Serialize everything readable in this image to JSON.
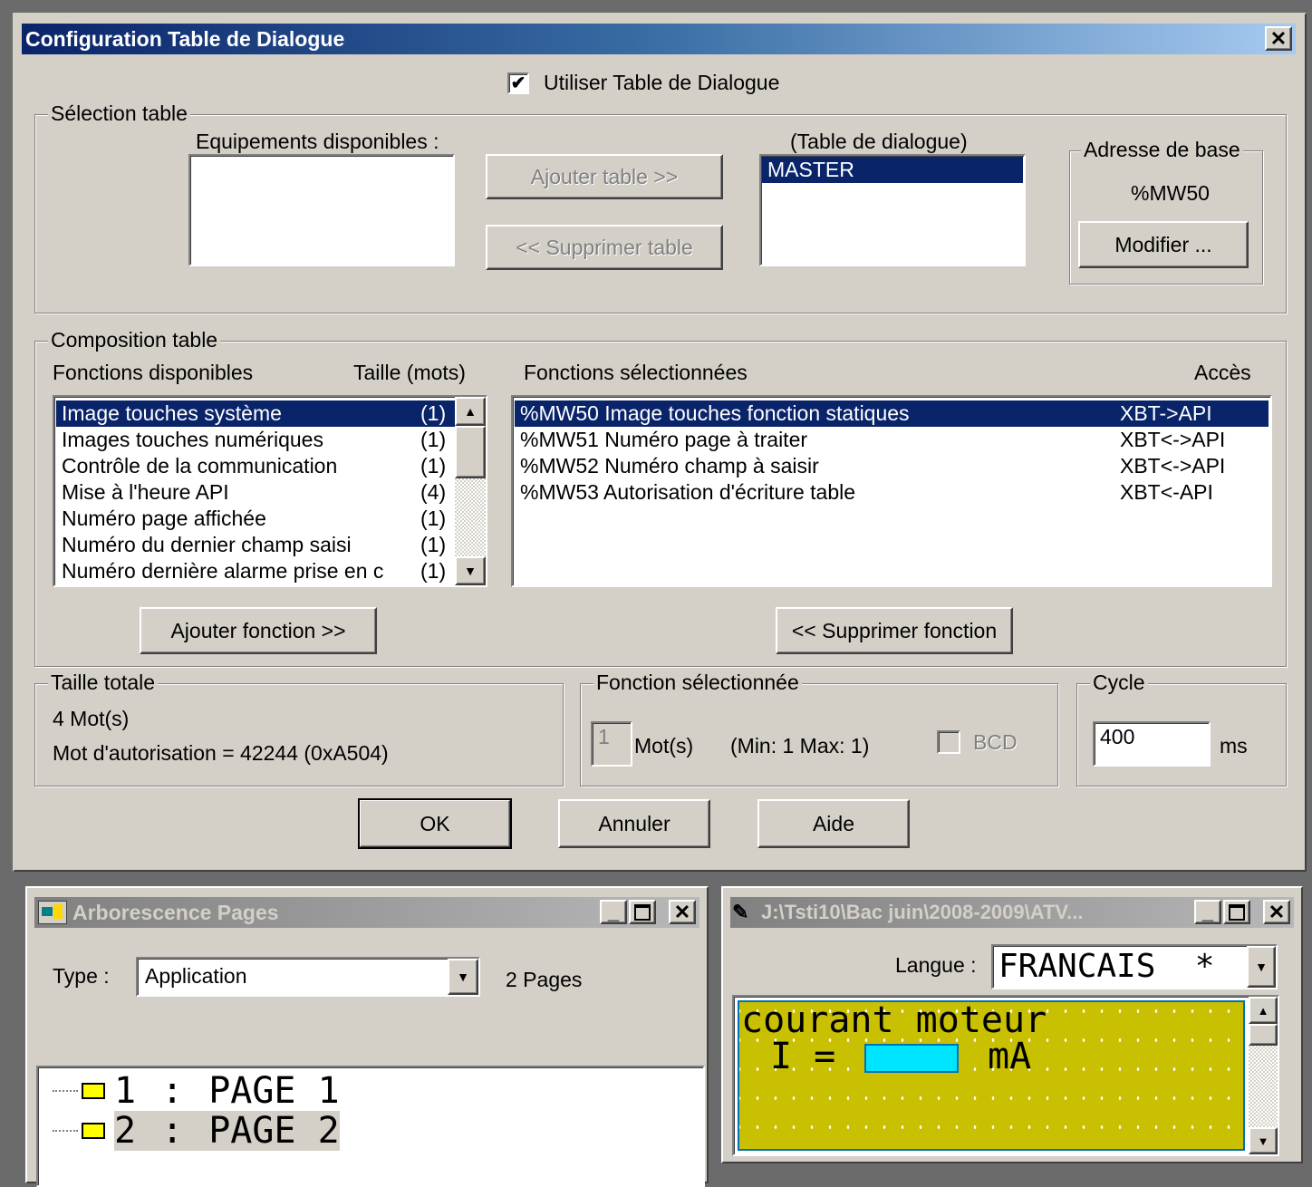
{
  "dialog": {
    "title": "Configuration Table de Dialogue",
    "close_glyph": "✕",
    "use_table_label": "Utiliser Table de Dialogue",
    "use_table_checked": true,
    "selection": {
      "legend": "Sélection table",
      "available_label": "Equipements disponibles :",
      "add_table": "Ajouter table >>",
      "remove_table": "<< Supprimer table",
      "table_label": "(Table de dialogue)",
      "table_items": [
        "MASTER"
      ],
      "base_legend": "Adresse de base",
      "base_value": "%MW50",
      "modify": "Modifier ..."
    },
    "composition": {
      "legend": "Composition table",
      "available_header": "Fonctions disponibles",
      "size_header": "Taille (mots)",
      "selected_header": "Fonctions sélectionnées",
      "access_header": "Accès",
      "available": [
        {
          "name": "Image touches système",
          "size": "(1)"
        },
        {
          "name": "Images touches numériques",
          "size": "(1)"
        },
        {
          "name": "Contrôle de la communication",
          "size": "(1)"
        },
        {
          "name": "Mise à l'heure API",
          "size": "(4)"
        },
        {
          "name": "Numéro page affichée",
          "size": "(1)"
        },
        {
          "name": "Numéro du dernier champ saisi",
          "size": "(1)"
        },
        {
          "name": "Numéro dernière alarme prise en c",
          "size": "(1)"
        }
      ],
      "selected": [
        {
          "name": "%MW50 Image touches fonction statiques",
          "access": "XBT->API"
        },
        {
          "name": "%MW51 Numéro page à traiter",
          "access": "XBT<->API"
        },
        {
          "name": "%MW52 Numéro champ à saisir",
          "access": "XBT<->API"
        },
        {
          "name": "%MW53 Autorisation d'écriture table",
          "access": "XBT<-API"
        }
      ],
      "add_function": "Ajouter fonction >>",
      "remove_function": "<< Supprimer fonction"
    },
    "total": {
      "legend": "Taille totale",
      "words": "4 Mot(s)",
      "auth": "Mot d'autorisation = 42244 (0xA504)"
    },
    "selected_function": {
      "legend": "Fonction sélectionnée",
      "value": "1",
      "unit": "Mot(s)",
      "range": "(Min: 1 Max: 1)",
      "bcd": "BCD"
    },
    "cycle": {
      "legend": "Cycle",
      "value": "400",
      "unit": "ms"
    },
    "ok": "OK",
    "cancel": "Annuler",
    "help": "Aide"
  },
  "pages_window": {
    "title": "Arborescence Pages",
    "type_label": "Type :",
    "type_value": "Application",
    "count": "2 Pages",
    "tree": [
      {
        "num": "1",
        "sep": ":",
        "name": "PAGE 1"
      },
      {
        "num": "2",
        "sep": ":",
        "name": "PAGE 2"
      }
    ]
  },
  "editor_window": {
    "title": "J:\\Tsti10\\Bac juin\\2008-2009\\ATV...",
    "lang_label": "Langue :",
    "lang_value": "FRANCAIS  *",
    "line1": "courant moteur",
    "line2_prefix": "I =",
    "line2_suffix": "mA"
  },
  "colors": {
    "dialog_title_start": "#0a246a",
    "dialog_title_end": "#a6caf0",
    "inactive_title_start": "#808080",
    "inactive_title_end": "#c0c0c0",
    "lcd_bg": "#c8c000",
    "lcd_field": "#00e5ff"
  }
}
